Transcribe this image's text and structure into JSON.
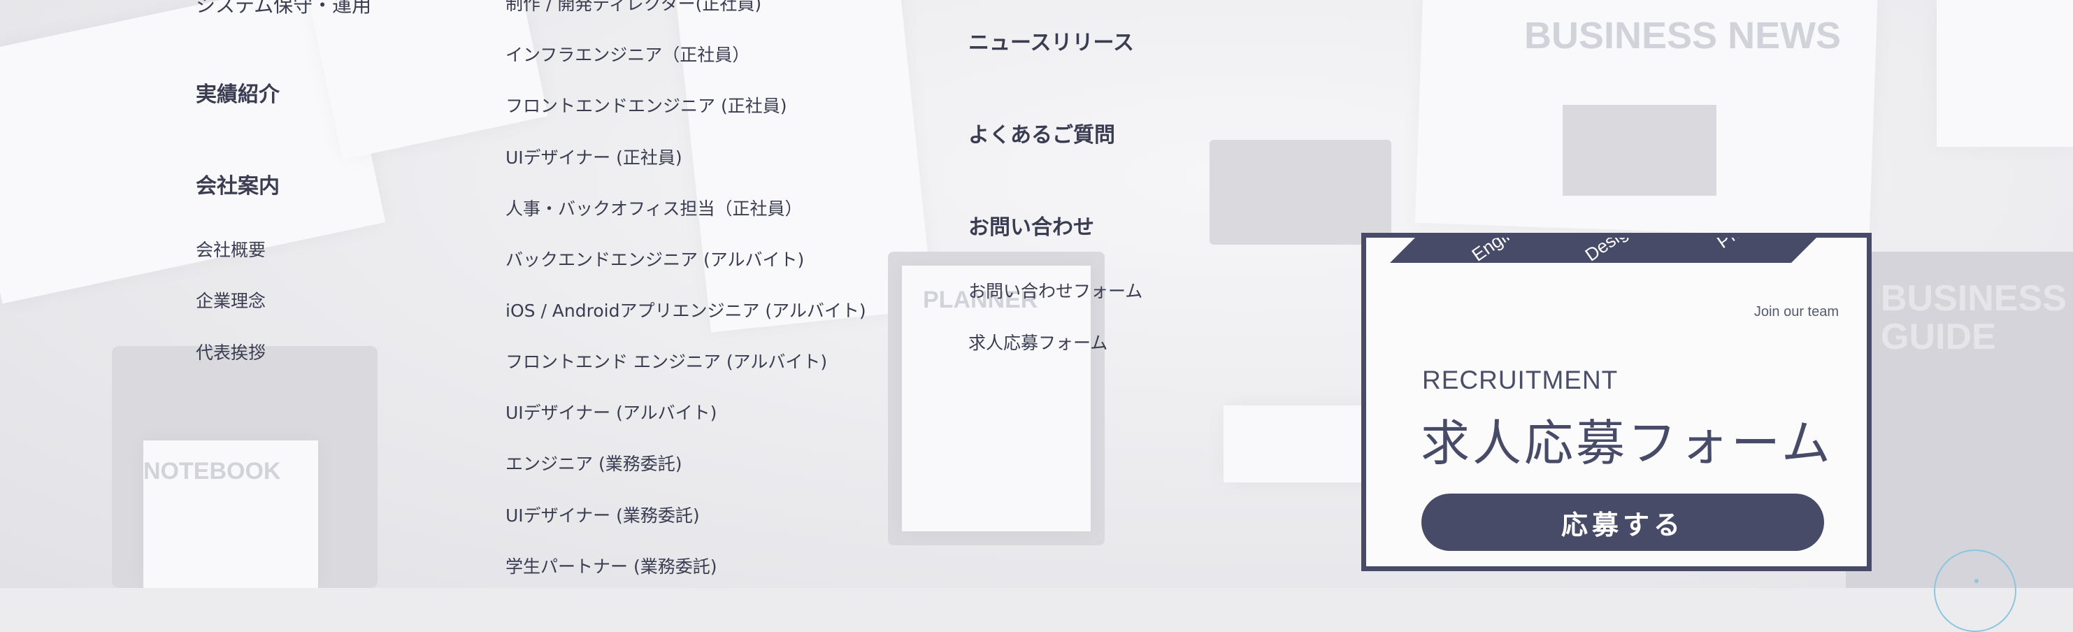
{
  "col1": {
    "top_item": "システム保守・運用",
    "headings": [
      "実績紹介",
      "会社案内"
    ],
    "company_links": [
      "会社概要",
      "企業理念",
      "代表挨拶"
    ]
  },
  "col2": {
    "jobs": [
      "制作 / 開発ディレクター(正社員)",
      "インフラエンジニア（正社員）",
      "フロントエンドエンジニア (正社員)",
      "UIデザイナー (正社員)",
      "人事・バックオフィス担当（正社員）",
      "バックエンドエンジニア (アルバイト)",
      "iOS / Androidアプリエンジニア (アルバイト)",
      "フロントエンド エンジニア (アルバイト)",
      "UIデザイナー (アルバイト)",
      "エンジニア (業務委託)",
      "UIデザイナー (業務委託)",
      "学生パートナー (業務委託)"
    ]
  },
  "col3": {
    "headings": [
      "ニュースリリース",
      "よくあるご質問",
      "お問い合わせ"
    ],
    "contact_links": [
      "お問い合わせフォーム",
      "求人応募フォーム"
    ]
  },
  "recruit": {
    "tags": [
      "Engineer",
      "Designer",
      "PM"
    ],
    "join": "Join our team",
    "title_en": "RECRUITMENT",
    "title_ja": "求人応募フォーム",
    "button": "応募する"
  },
  "background": {
    "news_text": "BUSINESS NEWS",
    "guide_text": "BUSINESS GUIDE",
    "notebook_text": "NOTEBOOK",
    "planner_text": "PLANNER"
  },
  "colors": {
    "text": "#3a3d51",
    "accent": "#474b67",
    "scroll_ring": "#8cc6df"
  }
}
